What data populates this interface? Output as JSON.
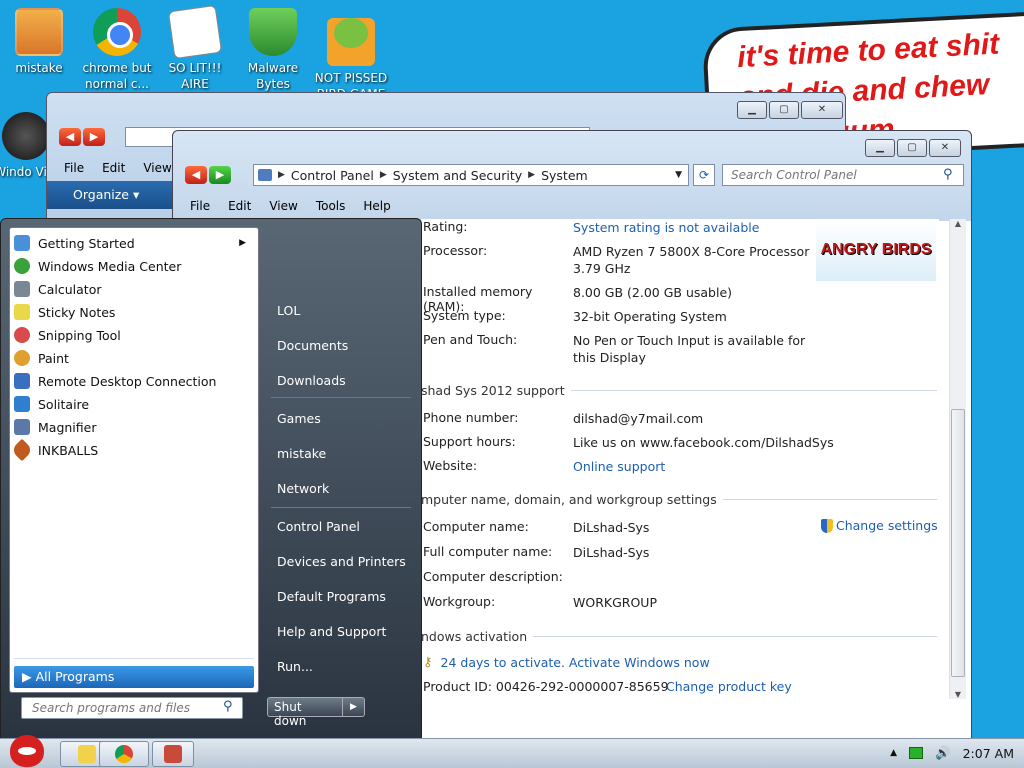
{
  "desktop": {
    "icons": [
      {
        "label": "mistake"
      },
      {
        "label": "chrome but normal c..."
      },
      {
        "label": "SO LIT!!! AIRE"
      },
      {
        "label": "Malware Bytes"
      },
      {
        "label": "NOT PISSED BIRD GAME"
      },
      {
        "label": "Windo Vist"
      }
    ],
    "bubble_lines": [
      "it's time to eat shit",
      "and die and chew",
      "gum"
    ],
    "colors": {
      "background": "#1aa3e0",
      "bubble_text": "#e01818"
    }
  },
  "back_window": {
    "menu": [
      "File",
      "Edit",
      "View"
    ],
    "organize": "Organize ▾"
  },
  "front_window": {
    "breadcrumb": [
      "Control Panel",
      "System and Security",
      "System"
    ],
    "search_placeholder": "Search Control Panel",
    "menu": [
      "File",
      "Edit",
      "View",
      "Tools",
      "Help"
    ],
    "system": {
      "rating_label": "Rating:",
      "rating_value": "System rating is not available",
      "processor_label": "Processor:",
      "processor_value": "AMD Ryzen 7 5800X 8-Core Processor 3.79 GHz",
      "memory_label": "Installed memory (RAM):",
      "memory_value": "8.00 GB (2.00 GB usable)",
      "type_label": "System type:",
      "type_value": "32-bit Operating System",
      "pen_label": "Pen and Touch:",
      "pen_value": "No Pen or Touch Input is available for this Display"
    },
    "support": {
      "heading": "shad Sys 2012 support",
      "phone_label": "Phone number:",
      "phone_value": "dilshad@y7mail.com",
      "hours_label": "Support hours:",
      "hours_value": "Like us on www.facebook.com/DilshadSys",
      "website_label": "Website:",
      "website_value": "Online support"
    },
    "computer": {
      "heading": "mputer name, domain, and workgroup settings",
      "name_label": "Computer name:",
      "name_value": "DiLshad-Sys",
      "full_label": "Full computer name:",
      "full_value": "DiLshad-Sys",
      "desc_label": "Computer description:",
      "workgroup_label": "Workgroup:",
      "workgroup_value": "WORKGROUP",
      "change_settings": "Change settings"
    },
    "activation": {
      "heading": "ndows activation",
      "days_text": "24 days to activate. Activate Windows now",
      "product_id": "Product ID: 00426-292-0000007-85659",
      "change_key": "Change product key"
    },
    "logo_text": "ANGRY BIRDS"
  },
  "start_menu": {
    "programs": [
      {
        "label": "Getting Started",
        "color": "#4a90d9"
      },
      {
        "label": "Windows Media Center",
        "color": "#3aa23a"
      },
      {
        "label": "Calculator",
        "color": "#7a8896"
      },
      {
        "label": "Sticky Notes",
        "color": "#e9d84a"
      },
      {
        "label": "Snipping Tool",
        "color": "#d94a4a"
      },
      {
        "label": "Paint",
        "color": "#e0a030"
      },
      {
        "label": "Remote Desktop Connection",
        "color": "#3a6fc0"
      },
      {
        "label": "Solitaire",
        "color": "#2e7fd0"
      },
      {
        "label": "Magnifier",
        "color": "#5a78a8"
      },
      {
        "label": "INKBALLS",
        "color": "#c05a20"
      }
    ],
    "all_programs": "All Programs",
    "search_placeholder": "Search programs and files",
    "right_items": [
      "LOL",
      "Documents",
      "Downloads",
      "Games",
      "mistake",
      "Network",
      "Control Panel",
      "Devices and Printers",
      "Default Programs",
      "Help and Support",
      "Run..."
    ],
    "shutdown": "Shut down"
  },
  "taskbar": {
    "clock": "2:07 AM"
  }
}
